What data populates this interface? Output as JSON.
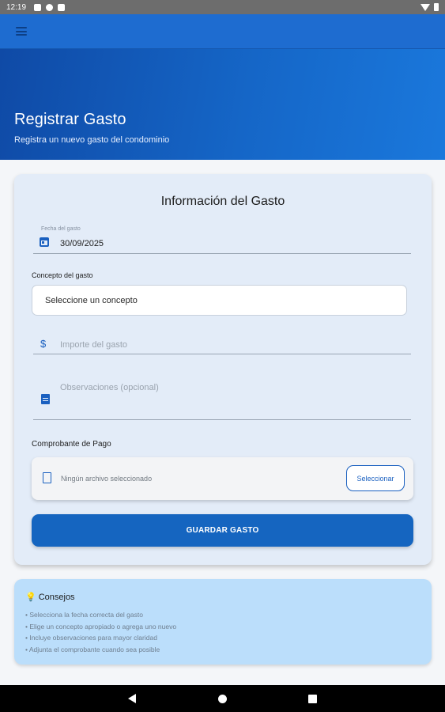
{
  "status_bar": {
    "time": "12:19"
  },
  "header": {
    "title": "Registrar Gasto",
    "subtitle": "Registra un nuevo gasto del condominio"
  },
  "form": {
    "title": "Información del Gasto",
    "date_label": "Fecha del gasto",
    "date_value": "30/09/2025",
    "concept_label": "Concepto del gasto",
    "concept_placeholder": "Seleccione un concepto",
    "amount_placeholder": "Importe del gasto",
    "amount_prefix": "$",
    "notes_placeholder": "Observaciones (opcional)",
    "receipt_label": "Comprobante de Pago",
    "no_file_text": "Ningún archivo seleccionado",
    "select_button": "Seleccionar",
    "save_button": "GUARDAR GASTO"
  },
  "tips": {
    "title": "Consejos",
    "items": [
      "• Selecciona la fecha correcta del gasto",
      "• Elige un concepto apropiado o agrega uno nuevo",
      "• Incluye observaciones para mayor claridad",
      "• Adjunta el comprobante cuando sea posible"
    ]
  },
  "colors": {
    "primary": "#1565c0",
    "header_gradient_start": "#0f4aa6",
    "header_gradient_end": "#1a78dc",
    "card_bg": "#e3ecf8",
    "tips_bg": "#bbdefb"
  },
  "icons": [
    "menu-icon",
    "calendar-icon",
    "dollar-icon",
    "document-icon",
    "file-icon",
    "lightbulb-icon",
    "back-icon",
    "home-icon",
    "recents-icon"
  ]
}
